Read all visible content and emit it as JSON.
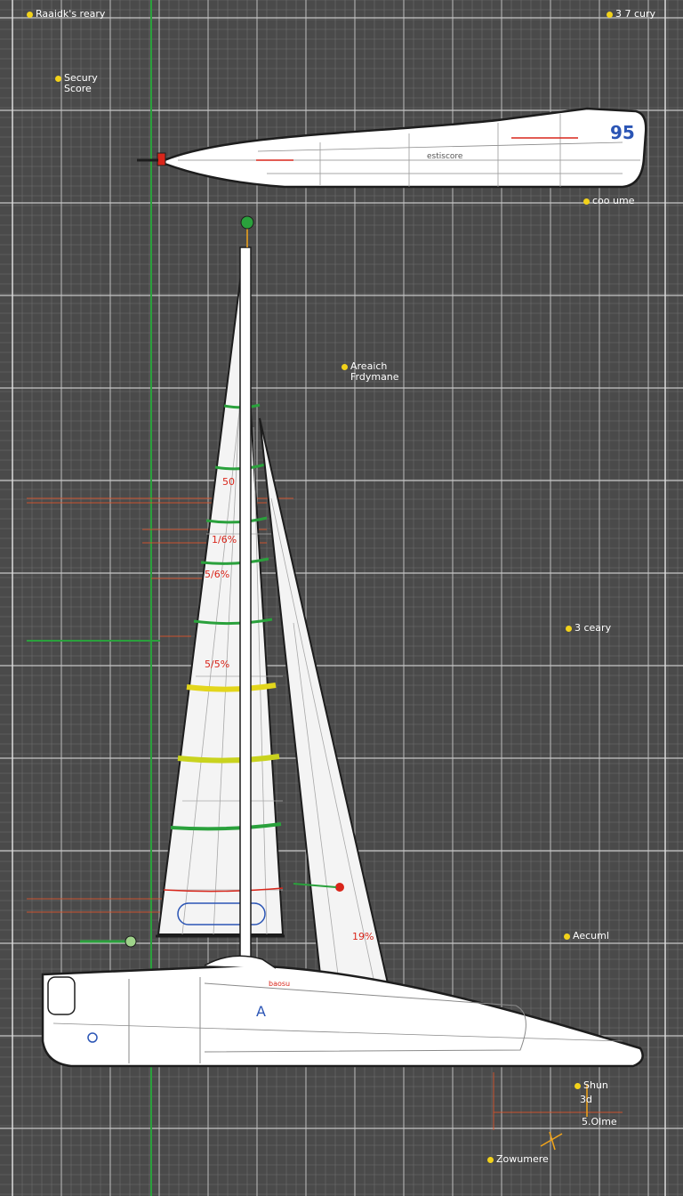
{
  "callouts": {
    "top_left": "Raaidk's reary",
    "top_right": "3 7 cury",
    "score_line1": "Secury",
    "score_line2": "Score",
    "side_view": "coo ume",
    "mast": [
      "Areaich",
      "Frdymane"
    ],
    "mid_right": "3 ceary",
    "lower_right": "Aecuml",
    "bottom_1": "Shun",
    "bottom_2": "3d",
    "bottom_3": "5.Olme",
    "bottom_4": "Zowumere"
  },
  "drawing": {
    "top_hull_number": "95",
    "top_hull_label": "estiscore",
    "sail_labels": [
      "50",
      "1/6%",
      "5/6%",
      "5/5%"
    ],
    "jib_label": "19%",
    "hull_label": "baosu",
    "hull_number": "A"
  },
  "colors": {
    "background": "#4a4a4a",
    "grid_major": "#c8c8c8",
    "grid_minor": "#6e6e6e",
    "accent_green": "#2aa13c",
    "accent_red": "#d9261b",
    "accent_yellow": "#f2d21a",
    "hull_fill": "#ffffff"
  }
}
